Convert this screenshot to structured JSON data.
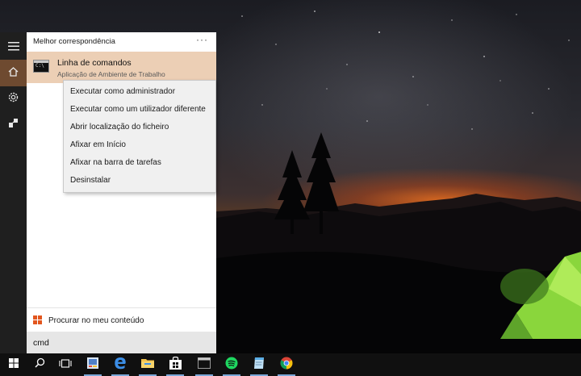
{
  "start_panel": {
    "best_match_label": "Melhor correspondência",
    "more_label": "···",
    "result": {
      "title": "Linha de comandos",
      "subtitle": "Aplicação de Ambiente de Trabalho",
      "icon": "command-prompt-icon",
      "icon_glyph": "C:\\"
    },
    "search_my_content_label": "Procurar no meu conteúdo",
    "search_query": "cmd"
  },
  "context_menu": {
    "items": [
      {
        "label": "Executar como administrador"
      },
      {
        "label": "Executar como um utilizador diferente"
      },
      {
        "label": "Abrir localização do ficheiro"
      },
      {
        "label": "Afixar em Início"
      },
      {
        "label": "Afixar na barra de tarefas"
      },
      {
        "label": "Desinstalar"
      }
    ]
  },
  "rail": {
    "items": [
      "menu-icon",
      "home-icon",
      "settings-icon",
      "feedback-icon"
    ],
    "active": "home-icon"
  },
  "taskbar": {
    "items": [
      "windows-start-icon",
      "search-icon",
      "task-view-icon",
      "paint-app-icon",
      "edge-browser-icon",
      "file-explorer-icon",
      "store-icon",
      "command-prompt-icon",
      "spotify-icon",
      "notepad-icon",
      "chrome-icon"
    ],
    "open_items": [
      "paint-app-icon",
      "edge-browser-icon",
      "file-explorer-icon",
      "store-icon",
      "command-prompt-icon",
      "spotify-icon",
      "notepad-icon",
      "chrome-icon"
    ]
  },
  "colors": {
    "accent": "#6e4a30",
    "result_highlight": "#eccfb5",
    "tent_green": "#8ad63c",
    "horizon_glow": "#e86a1e"
  }
}
